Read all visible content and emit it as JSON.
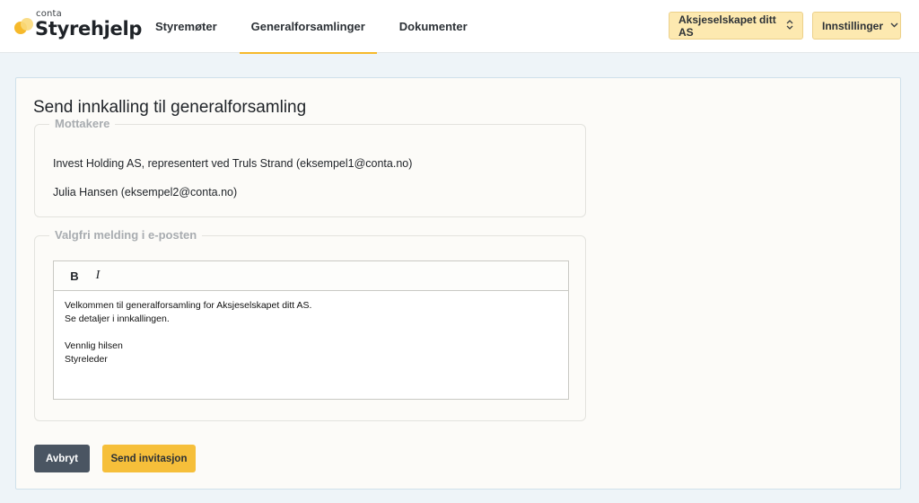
{
  "header": {
    "brand_small": "conta",
    "brand_name": "Styrehjelp",
    "nav": [
      {
        "label": "Styremøter",
        "active": false
      },
      {
        "label": "Generalforsamlinger",
        "active": true
      },
      {
        "label": "Dokumenter",
        "active": false
      }
    ],
    "company_select": {
      "label": "Aksjeselskapet ditt AS",
      "icon": "updown-chevron-icon"
    },
    "settings_menu": {
      "label": "Innstillinger",
      "icon": "chevron-down-icon"
    }
  },
  "main": {
    "title": "Send innkalling til generalforsamling",
    "recipients": {
      "legend": "Mottakere",
      "items": [
        "Invest Holding AS, representert ved Truls Strand (eksempel1@conta.no)",
        "Julia Hansen (eksempel2@conta.no)"
      ]
    },
    "message": {
      "legend": "Valgfri melding i e-posten",
      "toolbar": {
        "bold": "B",
        "italic": "I"
      },
      "lines": [
        "Velkommen til generalforsamling for Aksjeselskapet ditt AS.",
        "Se detaljer i innkallingen.",
        "",
        "Vennlig hilsen",
        "Styreleder"
      ]
    },
    "actions": {
      "cancel": "Avbryt",
      "send": "Send invitasjon"
    }
  },
  "colors": {
    "accent": "#f6b92b",
    "header_button_bg": "#fde9b0",
    "cancel_bg": "#4a5562",
    "send_bg": "#f6bf3a"
  }
}
